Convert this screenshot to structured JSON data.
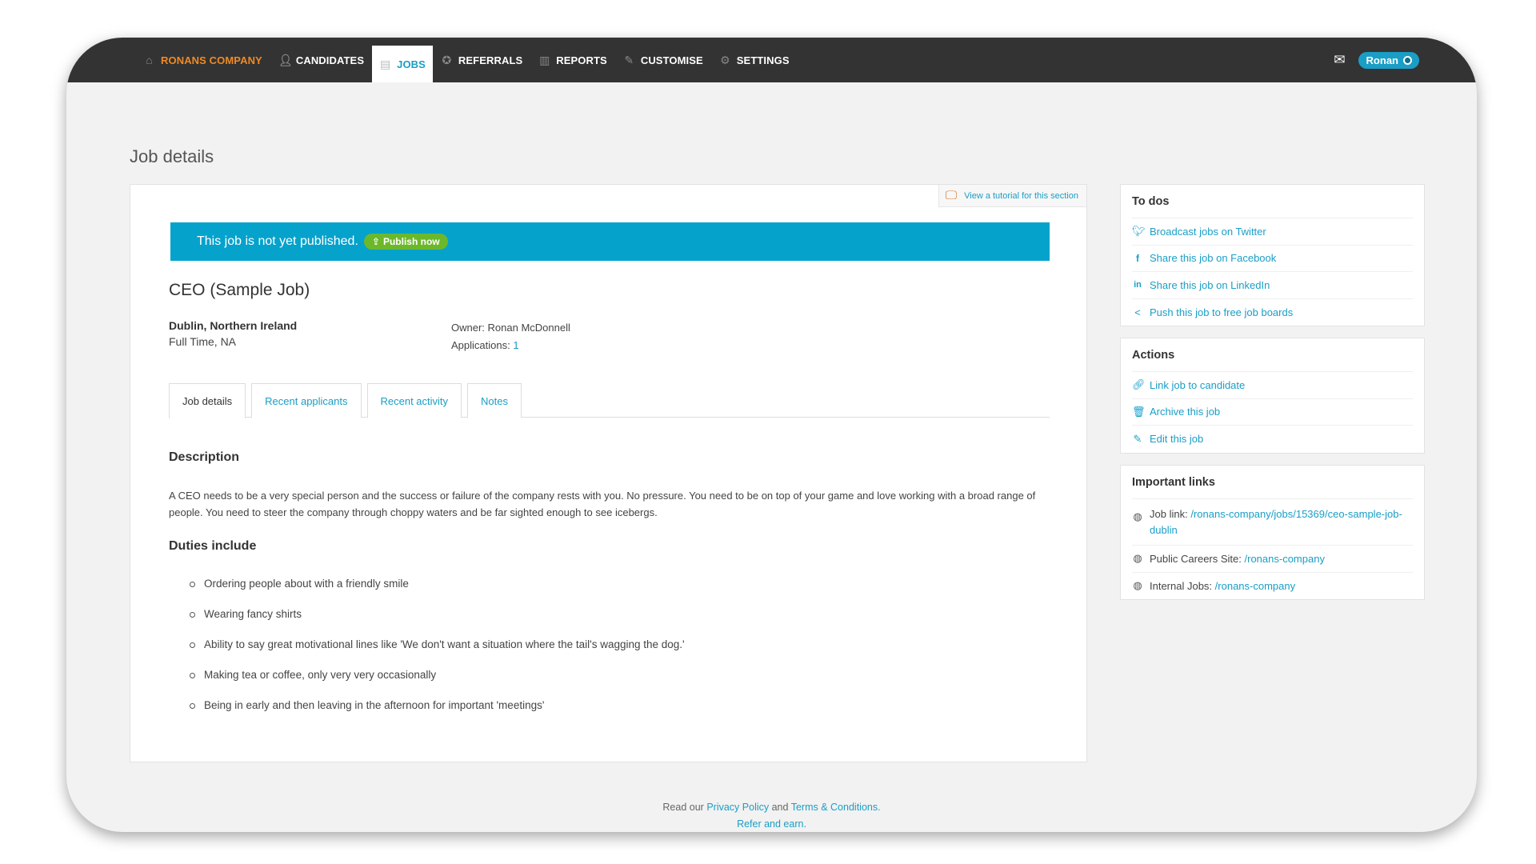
{
  "nav": {
    "items": [
      {
        "label": "RONANS COMPANY",
        "icon": "home-icon"
      },
      {
        "label": "CANDIDATES",
        "icon": "user-icon"
      },
      {
        "label": "JOBS",
        "icon": "document-icon"
      },
      {
        "label": "REFERRALS",
        "icon": "badge-icon"
      },
      {
        "label": "REPORTS",
        "icon": "bar-chart-icon"
      },
      {
        "label": "CUSTOMISE",
        "icon": "brush-icon"
      },
      {
        "label": "SETTINGS",
        "icon": "gear-icon"
      }
    ],
    "user_name": "Ronan"
  },
  "page": {
    "title": "Job details"
  },
  "tutorial": {
    "label": "View a tutorial for this section"
  },
  "banner": {
    "message": "This job is not yet published.",
    "publish_label": "Publish now"
  },
  "job": {
    "title": "CEO (Sample Job)",
    "location": "Dublin, Northern Ireland",
    "type": "Full Time, NA",
    "owner_label": "Owner:",
    "owner": "Ronan McDonnell",
    "applications_label": "Applications:",
    "applications": "1"
  },
  "tabs": [
    {
      "label": "Job details"
    },
    {
      "label": "Recent applicants"
    },
    {
      "label": "Recent activity"
    },
    {
      "label": "Notes"
    }
  ],
  "description": {
    "heading": "Description",
    "text": "A CEO needs to be a very special person and the success or failure of the company rests with you. No pressure. You need to be on top of your game and love working with a broad range of people. You need to steer the company through choppy waters and be far sighted enough to see icebergs.",
    "duties_heading": "Duties include",
    "duties": [
      "Ordering people about with a friendly smile",
      "Wearing fancy shirts",
      "Ability to say great motivational lines like 'We don't want a situation where the tail's wagging the dog.'",
      "Making tea or coffee, only very very occasionally",
      "Being in early and then leaving in the afternoon for important 'meetings'"
    ]
  },
  "todos": {
    "heading": "To dos",
    "items": [
      {
        "label": "Broadcast jobs on Twitter",
        "icon": "twitter-icon"
      },
      {
        "label": "Share this job on Facebook",
        "icon": "facebook-icon"
      },
      {
        "label": "Share this job on LinkedIn",
        "icon": "linkedin-icon"
      },
      {
        "label": "Push this job to free job boards",
        "icon": "share-icon"
      }
    ]
  },
  "actions": {
    "heading": "Actions",
    "items": [
      {
        "label": "Link job to candidate",
        "icon": "link-icon"
      },
      {
        "label": "Archive this job",
        "icon": "trash-icon"
      },
      {
        "label": "Edit this job",
        "icon": "pencil-icon"
      }
    ]
  },
  "links": {
    "heading": "Important links",
    "items": [
      {
        "label": "Job link:",
        "value": "/ronans-company/jobs/15369/ceo-sample-job-dublin",
        "icon": "globe-icon"
      },
      {
        "label": "Public Careers Site:",
        "value": "/ronans-company",
        "icon": "globe-icon"
      },
      {
        "label": "Internal Jobs:",
        "value": "/ronans-company",
        "icon": "globe-icon"
      }
    ]
  },
  "footer": {
    "prefix": "Read our",
    "privacy": "Privacy Policy",
    "and": "and",
    "terms": "Terms & Conditions.",
    "refer": "Refer and earn."
  },
  "colors": {
    "accent": "#1a9ec6",
    "banner": "#05a2cc",
    "publish": "#6cb82b",
    "nav_bg": "#333333",
    "company": "#f08a24"
  }
}
